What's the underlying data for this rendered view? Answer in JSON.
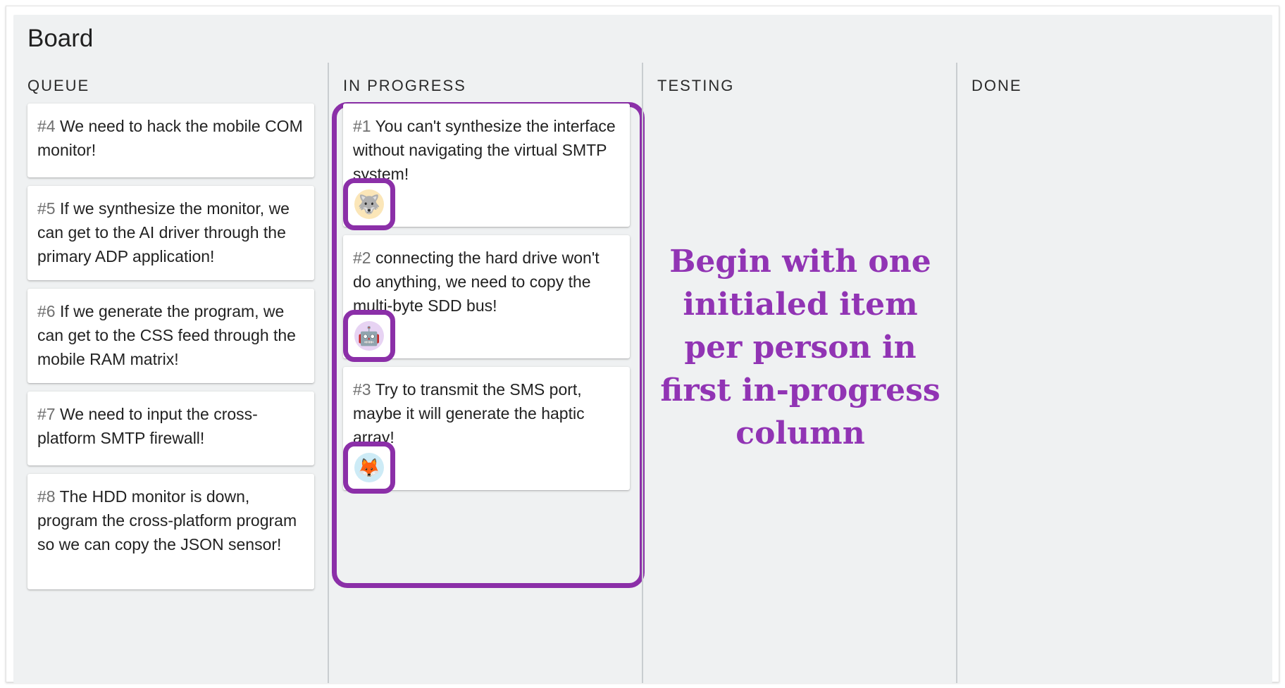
{
  "board": {
    "title": "Board"
  },
  "columns": [
    {
      "header": "QUEUE"
    },
    {
      "header": "IN PROGRESS"
    },
    {
      "header": "TESTING"
    },
    {
      "header": "DONE"
    }
  ],
  "queue_cards": [
    {
      "num": "#4",
      "text": " We need to hack the mobile COM monitor!"
    },
    {
      "num": "#5",
      "text": " If we synthesize the monitor, we can get to the AI driver through the primary ADP application!"
    },
    {
      "num": "#6",
      "text": " If we generate the program, we can get to the CSS feed through the mobile RAM matrix!"
    },
    {
      "num": "#7",
      "text": " We need to input the cross-platform SMTP firewall!"
    },
    {
      "num": "#8",
      "text": " The HDD monitor is down, program the cross-platform program so we can copy the JSON sensor!"
    }
  ],
  "in_progress_cards": [
    {
      "num": "#1",
      "text": " You can't synthesize the interface without navigating the virtual SMTP system!",
      "avatar": "wolf-avatar"
    },
    {
      "num": "#2",
      "text": " connecting the hard drive won't do anything, we need to copy the multi-byte SDD bus!",
      "avatar": "robot-avatar"
    },
    {
      "num": "#3",
      "text": " Try to transmit the SMS port, maybe it will generate the haptic array!",
      "avatar": "fox-avatar"
    }
  ],
  "annotation": {
    "text": "Begin with one initialed item per person in first in-progress column",
    "color": "#9134b4"
  },
  "colors": {
    "highlight": "#8b2fa8",
    "board_bg": "#eff1f2",
    "card_bg": "#ffffff"
  }
}
